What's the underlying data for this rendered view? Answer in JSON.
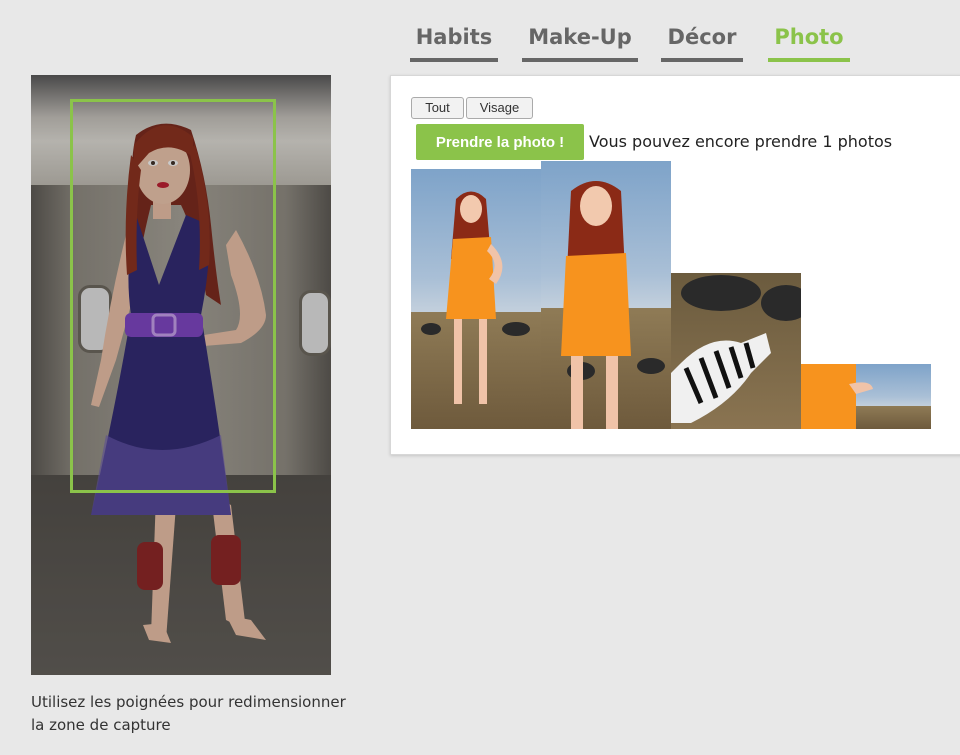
{
  "tabs": [
    {
      "label": "Habits",
      "active": false
    },
    {
      "label": "Make-Up",
      "active": false
    },
    {
      "label": "Décor",
      "active": false
    },
    {
      "label": "Photo",
      "active": true
    }
  ],
  "crop_buttons": {
    "all": "Tout",
    "face": "Visage"
  },
  "photo": {
    "take_button": "Prendre la photo !",
    "remaining_text": "Vous pouvez encore prendre 1 photos"
  },
  "helper_text": "Utilisez les poignées pour redimensionner la zone de capture",
  "colors": {
    "accent": "#8bc34a",
    "tab_inactive": "#666666",
    "background": "#e8e8e8",
    "dress": "#2a2270",
    "orange_dress": "#f7931e",
    "hair": "#8b2a16"
  },
  "icons": {
    "stage": "avatar-dress-up",
    "thumbs": [
      "full-body-orange-dress",
      "closeup-orange-dress",
      "zebra-closeup",
      "dress-crop-savanna"
    ]
  }
}
